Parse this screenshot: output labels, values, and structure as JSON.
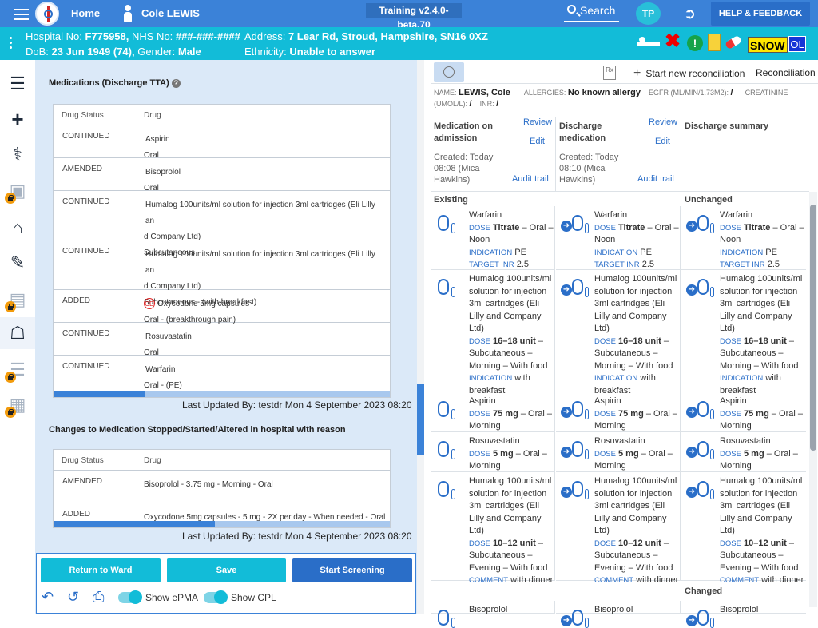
{
  "header": {
    "home": "Home",
    "user": "Cole LEWIS",
    "training": "Training v2.4.0-beta.70",
    "search": "Search",
    "initials": "TP",
    "help": "HELP & FEEDBACK"
  },
  "patient": {
    "hospital_label": "Hospital No:",
    "hospital_no": "F775958,",
    "nhs_label": "NHS No:",
    "nhs_no": "###-###-####",
    "address_label": "Address:",
    "address": "7 Lear Rd, Stroud, Hampshire, SN16 0XZ",
    "dob_label": "DoB:",
    "dob": "23 Jun 1949 (74),",
    "gender_label": "Gender:",
    "gender": "Male",
    "ethnicity_label": "Ethnicity:",
    "ethnicity": "Unable to answer",
    "snow": "SNOW",
    "ol": "OL"
  },
  "left": {
    "tta_title": "Medications (Discharge TTA)",
    "col_status": "Drug Status",
    "col_drug": "Drug",
    "tta_rows": [
      {
        "status": "CONTINUED",
        "l1": "Aspirin",
        "l2": "Oral"
      },
      {
        "status": "AMENDED",
        "l1": "Bisoprolol",
        "l2": "Oral"
      },
      {
        "status": "CONTINUED",
        "l1": "Humalog 100units/ml solution for injection 3ml cartridges (Eli Lilly an",
        "l1b": "d Company Ltd)",
        "l2": "Subcutaneous"
      },
      {
        "status": "CONTINUED",
        "l1": "Humalog 100units/ml solution for injection 3ml cartridges (Eli Lilly an",
        "l1b": "d Company Ltd)",
        "l2": "Subcutaneous - (with breakfast)"
      },
      {
        "status": "ADDED",
        "cd": "CD",
        "l1": "Oxycodone 5mg capsules",
        "l2": "Oral - (breakthrough pain)"
      },
      {
        "status": "CONTINUED",
        "l1": "Rosuvastatin",
        "l2": "Oral"
      },
      {
        "status": "CONTINUED",
        "l1": "Warfarin",
        "l2": "Oral - (PE)"
      }
    ],
    "updated": "Last Updated By: testdr Mon 4 September 2023 08:20",
    "changes_title": "Changes to Medication Stopped/Started/Altered in hospital with reason",
    "change_rows": [
      {
        "status": "AMENDED",
        "drug": "Bisoprolol - 3.75 mg - Morning - Oral"
      },
      {
        "status": "ADDED",
        "drug": "Oxycodone 5mg capsules - 5 mg - 2X per day - When needed - Oral"
      }
    ],
    "updated2": "Last Updated By: testdr Mon 4 September 2023 08:20",
    "tta_scroll_fraction": 0.27,
    "changes_scroll_fraction": 0.48
  },
  "buttons": {
    "return": "Return to Ward",
    "save": "Save",
    "screening": "Start Screening",
    "show_epma": "Show ePMA",
    "show_cpl": "Show CPL"
  },
  "right": {
    "start_rec": "Start new reconciliation",
    "rec_status": "Reconciliation st",
    "rx": "Rx",
    "name_label": "NAME:",
    "name": "LEWIS, Cole",
    "allergy_label": "ALLERGIES:",
    "allergy": "No known allergy",
    "egfr_label": "EGFR (ML/MIN/1.73M2):",
    "egfr": "/",
    "creat_label": "CREATININE",
    "creat_unit": "(UMOL/L):",
    "creat": "/",
    "inr_label": "INR:",
    "inr": "/",
    "adm_title": "Medication on admission",
    "adm_review": "Review",
    "adm_edit": "Edit",
    "adm_created": "Created: Today 08:08 (Mica Hawkins)",
    "adm_audit": "Audit trail",
    "dis_title": "Discharge medication",
    "dis_review": "Review",
    "dis_edit": "Edit",
    "dis_created": "Created: Today 08:10 (Mica Hawkins)",
    "dis_audit": "Audit trail",
    "sum_title": "Discharge summary",
    "existing": "Existing",
    "unchanged": "Unchanged",
    "changed": "Changed",
    "meds": [
      {
        "name": "Warfarin",
        "dose_k": "DOSE",
        "dose": "Titrate",
        "route": " – Oral – Noon",
        "ind_k": "INDICATION",
        "ind": " PE",
        "inr_k": "TARGET INR",
        "inr": " 2.5"
      },
      {
        "name": "Humalog 100units/ml solution for injection 3ml cartridges (Eli Lilly and Company Ltd)",
        "dose_k": "DOSE",
        "dose": "16–18 unit",
        "route": " – Subcutaneous – Morning – With food",
        "ind_k": "INDICATION",
        "ind": " with breakfast"
      },
      {
        "name": "Aspirin",
        "dose_k": "DOSE",
        "dose": "75 mg",
        "route": " – Oral – Morning"
      },
      {
        "name": "Rosuvastatin",
        "dose_k": "DOSE",
        "dose": "5 mg",
        "route": " – Oral – Morning"
      },
      {
        "name": "Humalog 100units/ml solution for injection 3ml cartridges (Eli Lilly and Company Ltd)",
        "dose_k": "DOSE",
        "dose": "10–12 unit",
        "route": " – Subcutaneous – Evening – With food",
        "com_k": "COMMENT",
        "com": " with dinner"
      },
      {
        "name": "Bisoprolol"
      }
    ]
  },
  "colors": {
    "topbar": "#3b82d8",
    "patientbar": "#12bcd8",
    "accent": "#2a6ec8",
    "panel": "#dbe9f8"
  },
  "icons": [
    "hamburger-icon",
    "caduceus-logo",
    "person-icon",
    "search-icon",
    "sign-out-icon",
    "bed-icon",
    "red-x-icon",
    "alert-icon",
    "potassium-icon",
    "pill-icon"
  ]
}
